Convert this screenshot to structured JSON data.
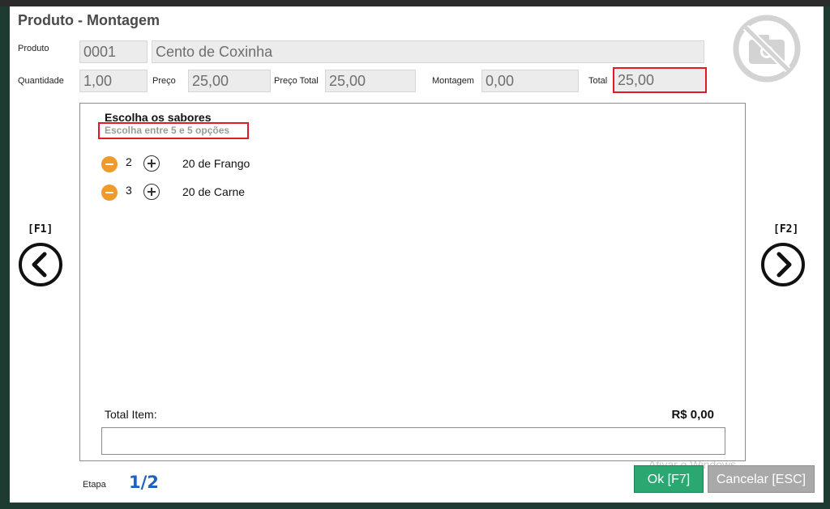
{
  "window": {
    "title": "Produto - Montagem"
  },
  "fields": {
    "produto_label": "Produto",
    "produto_code": "0001",
    "produto_name": "Cento de Coxinha",
    "quantidade_label": "Quantidade",
    "quantidade_value": "1,00",
    "preco_label": "Preço",
    "preco_value": "25,00",
    "preco_total_label": "Preço Total",
    "preco_total_value": "25,00",
    "montagem_label": "Montagem",
    "montagem_value": "0,00",
    "total_label": "Total",
    "total_value": "25,00"
  },
  "image_placeholder_icon": "no-camera-icon",
  "flavors": {
    "title": "Escolha os sabores",
    "subtitle": "Escolha entre 5 e 5 opções",
    "items": [
      {
        "qty": "2",
        "name": "20 de Frango"
      },
      {
        "qty": "3",
        "name": "20 de Carne"
      }
    ],
    "total_item_label": "Total Item:",
    "total_item_value": "R$ 0,00"
  },
  "nav": {
    "prev_key": "[F1]",
    "next_key": "[F2]",
    "prev_icon": "chevron-left-circle-icon",
    "next_icon": "chevron-right-circle-icon"
  },
  "etapa": {
    "label": "Etapa",
    "value": "1/2"
  },
  "buttons": {
    "ok": "Ok [F7]",
    "cancel": "Cancelar [ESC]"
  },
  "watermark": "Ativar o Windows",
  "colors": {
    "minus_button": "#ef9a2a",
    "ok_button": "#2ba772",
    "cancel_button": "#a9a9a9",
    "etapa": "#1e62c4",
    "highlight_border": "#e01b24"
  }
}
